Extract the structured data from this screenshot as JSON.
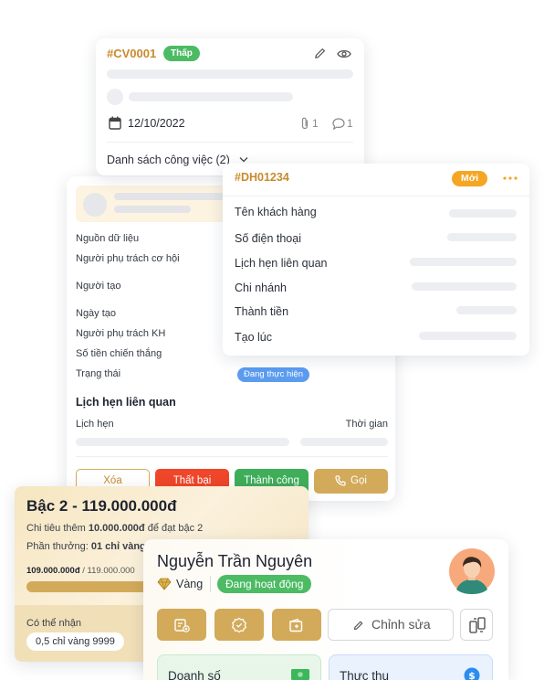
{
  "task_card": {
    "code": "#CV0001",
    "priority": "Thấp",
    "date": "12/10/2022",
    "attachments": "1",
    "comments": "1",
    "task_list": "Danh sách công việc (2)"
  },
  "opportunity_card": {
    "labels": [
      "Nguồn dữ liệu",
      "Người phụ trách cơ hội",
      "Người tạo",
      "Ngày tạo",
      "Người phụ trách KH",
      "Số tiền chiến thắng",
      "Trạng thái"
    ],
    "status": "Đang thực hiện",
    "section_title": "Lịch hẹn liên quan",
    "col_appointment": "Lịch hẹn",
    "col_time": "Thời gian",
    "buttons": {
      "delete": "Xóa",
      "lose": "Thất bại",
      "success": "Thành công",
      "call": "Gọi"
    }
  },
  "order_card": {
    "code": "#DH01234",
    "badge": "Mới",
    "rows": [
      "Tên khách hàng",
      "Số điện thoại",
      "Lịch hẹn liên quan",
      "Chi nhánh",
      "Thành tiền",
      "Tạo lúc"
    ]
  },
  "level_card": {
    "title": "Bậc 2 - 119.000.000đ",
    "spend_prefix": "Chi tiêu thêm ",
    "spend_amount": "10.000.000đ",
    "spend_suffix": " để đạt bậc 2",
    "reward_prefix": "Phần thưởng: ",
    "reward_value": "01 chỉ vàng",
    "progress_current": "109.000.000đ",
    "progress_total": "/ 119.000.000",
    "progress_fraction": 0.916,
    "receivable_label": "Có thể nhận",
    "receivable_value": "0,5 chỉ vàng 9999"
  },
  "customer_card": {
    "name": "Nguyễn Trần Nguyên",
    "tier": "Vàng",
    "status": "Đang hoạt động",
    "edit_label": "Chỉnh sửa",
    "revenue_label": "Doanh số",
    "collected_label": "Thực thu"
  },
  "colors": {
    "accent_gold": "#d2aa5a",
    "green": "#4cbb64",
    "red": "#f0462a",
    "orange_badge": "#f5a623",
    "blue_status": "#5b9cf0"
  }
}
